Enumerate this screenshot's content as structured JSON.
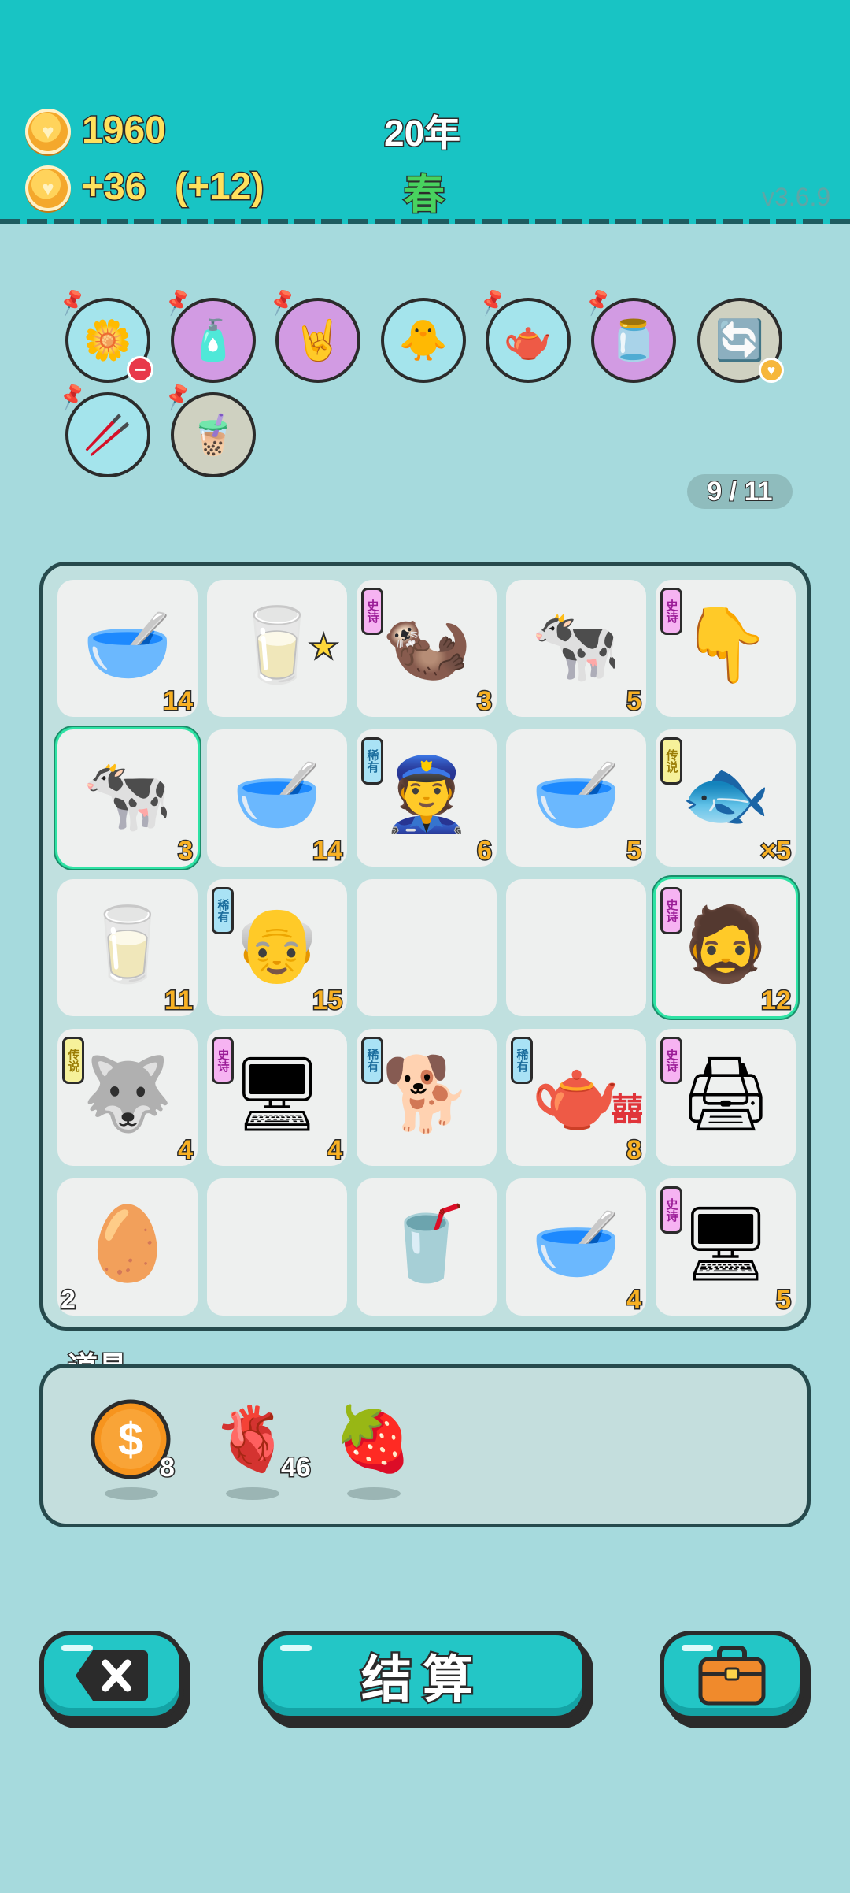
{
  "header": {
    "coins": "1960",
    "income": "+36",
    "bonus": "(+12)",
    "year": "20年",
    "season": "春",
    "version": "v3.6.9"
  },
  "skills": [
    {
      "icon": "flower-pot-icon",
      "glyph": "🌼",
      "color": "teal",
      "pinned": true,
      "badge": "minus"
    },
    {
      "icon": "spray-bottle-icon",
      "glyph": "🧴",
      "color": "purple",
      "pinned": true
    },
    {
      "icon": "rock-hand-icon",
      "glyph": "🤘",
      "color": "purple",
      "pinned": true
    },
    {
      "icon": "duck-pot-icon",
      "glyph": "🐥",
      "color": "teal",
      "pinned": false
    },
    {
      "icon": "gravy-boat-icon",
      "glyph": "🫖",
      "color": "teal",
      "pinned": true
    },
    {
      "icon": "jar-icon",
      "glyph": "🫙",
      "color": "purple",
      "pinned": true
    },
    {
      "icon": "refresh-icon",
      "glyph": "🔄",
      "color": "gray",
      "pinned": false,
      "badge": "heart"
    },
    {
      "icon": "straws-icon",
      "glyph": "🥢",
      "color": "teal",
      "pinned": true
    },
    {
      "icon": "bubble-tea-icon",
      "glyph": "🧋",
      "color": "gray",
      "pinned": true
    }
  ],
  "counter": "9 / 11",
  "board": [
    {
      "name": "bowl",
      "glyph": "🥣",
      "count": "14"
    },
    {
      "name": "milk-bottle",
      "glyph": "🥛",
      "count": "",
      "star": true
    },
    {
      "name": "otter",
      "glyph": "🦦",
      "count": "3",
      "tag": "史诗",
      "tagType": "epic"
    },
    {
      "name": "cow",
      "glyph": "🐄",
      "count": "5"
    },
    {
      "name": "pointing-hand",
      "glyph": "👇",
      "count": "",
      "tag": "史诗",
      "tagType": "epic"
    },
    {
      "name": "cow",
      "glyph": "🐄",
      "count": "3",
      "selected": true
    },
    {
      "name": "bowl",
      "glyph": "🥣",
      "count": "14"
    },
    {
      "name": "police-officer",
      "glyph": "👮",
      "count": "6",
      "tag": "稀有",
      "tagType": "rare"
    },
    {
      "name": "bowl",
      "glyph": "🥣",
      "count": "5"
    },
    {
      "name": "koi-fish",
      "glyph": "🐟",
      "count": "×5",
      "tag": "传说",
      "tagType": "legend"
    },
    {
      "name": "milk-bottle",
      "glyph": "🥛",
      "count": "11"
    },
    {
      "name": "bald-man",
      "glyph": "👴",
      "count": "15",
      "tag": "稀有",
      "tagType": "rare"
    },
    {
      "name": "empty",
      "glyph": "",
      "count": ""
    },
    {
      "name": "empty",
      "glyph": "",
      "count": ""
    },
    {
      "name": "bearded-man",
      "glyph": "🧔",
      "count": "12",
      "tag": "史诗",
      "tagType": "epic",
      "selected": true
    },
    {
      "name": "husky-king",
      "glyph": "🐺",
      "count": "4",
      "tag": "传说",
      "tagType": "legend"
    },
    {
      "name": "graphics-card",
      "glyph": "🖥",
      "count": "4",
      "tag": "史诗",
      "tagType": "epic"
    },
    {
      "name": "husky",
      "glyph": "🐕",
      "count": "",
      "tag": "稀有",
      "tagType": "rare"
    },
    {
      "name": "teapot",
      "glyph": "🫖",
      "count": "8",
      "tag": "稀有",
      "tagType": "rare",
      "extra": "囍"
    },
    {
      "name": "printer",
      "glyph": "🖨",
      "count": "",
      "tag": "史诗",
      "tagType": "epic"
    },
    {
      "name": "egg",
      "glyph": "🥚",
      "count": "2",
      "countLeft": true
    },
    {
      "name": "empty",
      "glyph": "",
      "count": ""
    },
    {
      "name": "cup",
      "glyph": "🥤",
      "count": ""
    },
    {
      "name": "bowl",
      "glyph": "🥣",
      "count": "4"
    },
    {
      "name": "graphics-card",
      "glyph": "🖥",
      "count": "5",
      "tag": "史诗",
      "tagType": "epic"
    }
  ],
  "tools": {
    "title": "道具",
    "items": [
      {
        "name": "dollar-coin-icon",
        "glyph": "💲",
        "count": "8"
      },
      {
        "name": "liver-icon",
        "glyph": "🫀",
        "count": "46"
      },
      {
        "name": "strawberry-icon",
        "glyph": "🍓",
        "count": ""
      }
    ]
  },
  "buttons": {
    "settle": "结算"
  },
  "colors": {
    "header": "#18c4c4",
    "background": "#a6dadd",
    "button": "#23c6c6",
    "count": "#f7b023"
  }
}
